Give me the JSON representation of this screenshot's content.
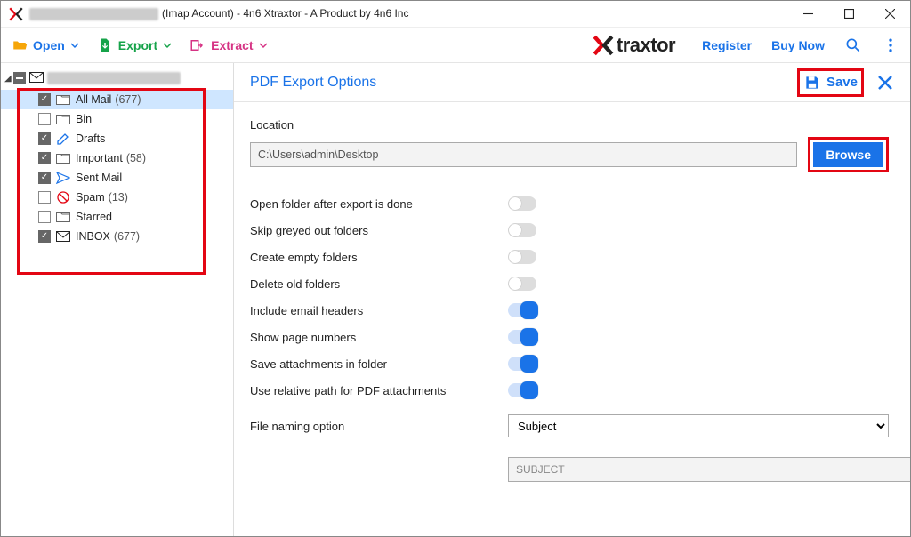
{
  "window": {
    "title_suffix": "(Imap Account) - 4n6 Xtraxtor - A Product by 4n6 Inc"
  },
  "toolbar": {
    "open": "Open",
    "export": "Export",
    "extract": "Extract",
    "brand": "traxtor",
    "register": "Register",
    "buynow": "Buy Now"
  },
  "sidebar": {
    "items": [
      {
        "checked": true,
        "icon": "folder",
        "name": "All Mail",
        "count": "(677)",
        "selected": true
      },
      {
        "checked": false,
        "icon": "folder",
        "name": "Bin",
        "count": "",
        "selected": false
      },
      {
        "checked": true,
        "icon": "drafts",
        "name": "Drafts",
        "count": "",
        "selected": false
      },
      {
        "checked": true,
        "icon": "folder",
        "name": "Important",
        "count": "(58)",
        "selected": false
      },
      {
        "checked": true,
        "icon": "sent",
        "name": "Sent Mail",
        "count": "",
        "selected": false
      },
      {
        "checked": false,
        "icon": "spam",
        "name": "Spam",
        "count": "(13)",
        "selected": false
      },
      {
        "checked": false,
        "icon": "folder",
        "name": "Starred",
        "count": "",
        "selected": false
      },
      {
        "checked": true,
        "icon": "inbox",
        "name": "INBOX",
        "count": "(677)",
        "selected": false
      }
    ]
  },
  "panel": {
    "title": "PDF Export Options",
    "save": "Save",
    "location_label": "Location",
    "location_value": "C:\\Users\\admin\\Desktop",
    "browse": "Browse",
    "options": [
      {
        "label": "Open folder after export is done",
        "on": false
      },
      {
        "label": "Skip greyed out folders",
        "on": false
      },
      {
        "label": "Create empty folders",
        "on": false
      },
      {
        "label": "Delete old folders",
        "on": false
      },
      {
        "label": "Include email headers",
        "on": true
      },
      {
        "label": "Show page numbers",
        "on": true
      },
      {
        "label": "Save attachments in folder",
        "on": true
      },
      {
        "label": "Use relative path for PDF attachments",
        "on": true
      }
    ],
    "naming_label": "File naming option",
    "naming_value": "Subject",
    "subject_placeholder": "SUBJECT"
  }
}
